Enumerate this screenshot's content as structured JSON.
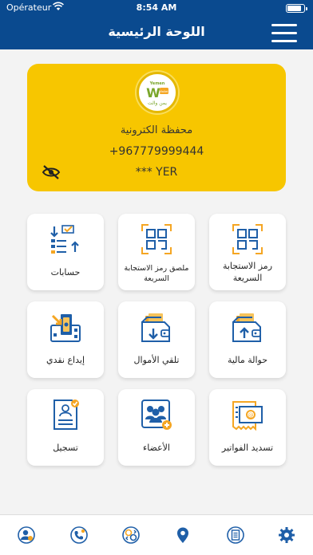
{
  "status": {
    "carrier": "Opérateur",
    "time": "8:54 AM"
  },
  "header": {
    "title": "اللوحة الرئيسية"
  },
  "wallet": {
    "logo_text": [
      "Yemen",
      "Wallet",
      "يمن والت"
    ],
    "name": "محفظة الكترونية",
    "phone": "+967779999444",
    "balance": "*** YER"
  },
  "tiles": [
    {
      "label": "رمز الاستجابة السريعة",
      "icon": "qr-code-icon"
    },
    {
      "label": "ملصق رمز الاستجابة السريعة",
      "icon": "qr-sticker-icon"
    },
    {
      "label": "حسابات",
      "icon": "accounts-icon"
    },
    {
      "label": "حوالة مالية",
      "icon": "money-transfer-icon"
    },
    {
      "label": "تلقي الأموال",
      "icon": "receive-money-icon"
    },
    {
      "label": "إيداع نقدي",
      "icon": "cash-deposit-icon"
    },
    {
      "label": "تسديد الفواتير",
      "icon": "pay-bills-icon"
    },
    {
      "label": "الأعضاء",
      "icon": "members-icon"
    },
    {
      "label": "تسجيل",
      "icon": "register-icon"
    }
  ],
  "bottom_tabs": [
    "profile-icon",
    "support-phone-icon",
    "exchange-icon",
    "location-icon",
    "document-icon",
    "settings-icon"
  ],
  "colors": {
    "primary": "#0a4a8f",
    "accent": "#f7c600",
    "icon_blue": "#1f5fa8",
    "icon_orange": "#f5a623"
  }
}
